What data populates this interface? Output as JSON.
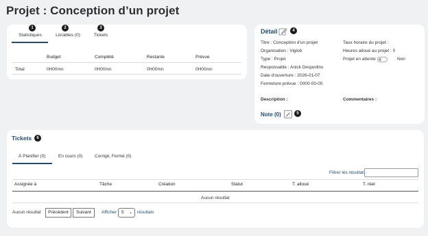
{
  "page": {
    "title": "Projet : Conception d’un projet"
  },
  "stats": {
    "tabs": [
      {
        "label": "Statistiques",
        "badge": "1"
      },
      {
        "label": "Livrables (0)",
        "badge": "2"
      },
      {
        "label": "Tickets",
        "badge": "3"
      }
    ],
    "columns": [
      "",
      "Budget",
      "Complété",
      "Restante",
      "Prévue"
    ],
    "rows": [
      {
        "label": "Total",
        "values": [
          "0H00mn",
          "0H00mn",
          "0H00mn",
          "0H00mn"
        ]
      }
    ]
  },
  "detail": {
    "title": "Détail",
    "badge": "4",
    "left_fields": [
      "Titre : Conception d'un projet",
      "Organisation : Viglob",
      "Type : Projet",
      "Responsable : Anick Desjardins",
      "Date d'ouverture : 2026-01-07",
      "Fermeture prévue : 0000-00-00"
    ],
    "right_fields": [
      "Taux horaire du projet :",
      "Heures alloué au projet : 0"
    ],
    "on_hold_label": "Projet en attente :",
    "on_hold_value": "Non",
    "description_label": "Description :",
    "comments_label": "Commentaires :",
    "note_label": "Note (0)",
    "note_badge": "5"
  },
  "tickets": {
    "title": "Tickets",
    "badge": "6",
    "tabs": [
      "À Planifier (0)",
      "En cours (0)",
      "Corrigé, Fermé (0)"
    ],
    "filter_label": "Filtrer les résultats",
    "filter_value": "",
    "columns": [
      "Assignée à",
      "Tâche",
      "Création",
      "Statut",
      "T. alloué",
      "T. réel"
    ],
    "empty_text": "Aucun résultat",
    "footer": {
      "status": "Aucun résultat",
      "prev_label": "Précédent",
      "next_label": "Suivant",
      "show_label": "Afficher",
      "page_size": "5",
      "results_label": "résultats"
    }
  },
  "colors": {
    "accent": "#1f4a73",
    "background": "#eff1f3",
    "badge": "#1a1a1a"
  }
}
